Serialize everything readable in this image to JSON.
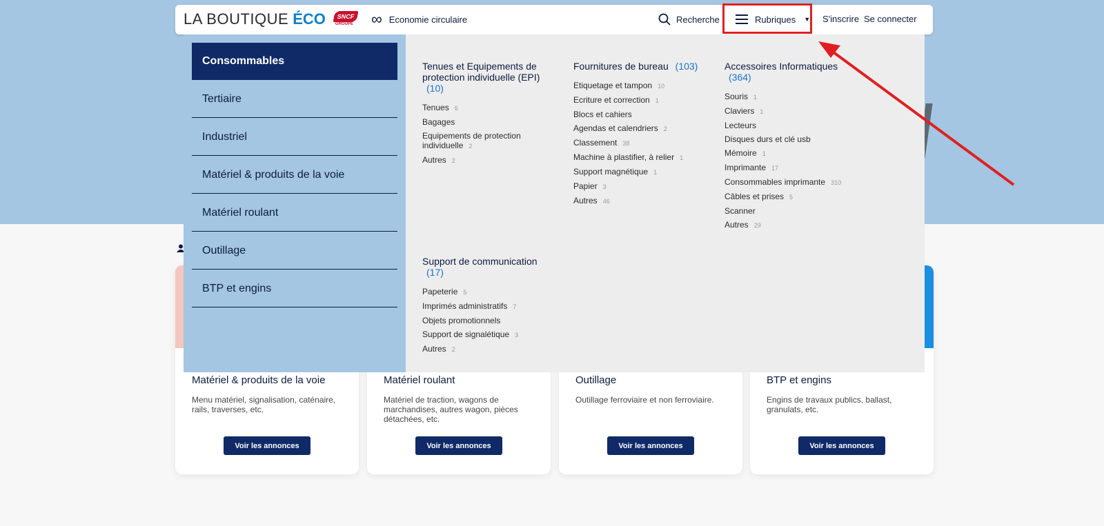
{
  "header": {
    "logo_text": "LA BOUTIQUE",
    "logo_eco": "ÉCO",
    "logo_badge": "SNCF",
    "logo_badge_sub": "GROUPE",
    "eco_link": "Economie circulaire",
    "search": "Recherche",
    "rubriques": "Rubriques",
    "signup": "S'inscrire",
    "login": "Se connecter"
  },
  "sidebar": {
    "items": [
      {
        "label": "Consommables"
      },
      {
        "label": "Tertiaire"
      },
      {
        "label": "Industriel"
      },
      {
        "label": "Matériel & produits de la voie"
      },
      {
        "label": "Matériel roulant"
      },
      {
        "label": "Outillage"
      },
      {
        "label": "BTP et engins"
      }
    ]
  },
  "menu": {
    "epi": {
      "title": "Tenues et Equipements de protection individuelle (EPI)",
      "count": "(10)",
      "items": [
        {
          "label": "Tenues",
          "n": "6"
        },
        {
          "label": "Bagages",
          "n": ""
        },
        {
          "label": "Equipements de protection individuelle",
          "n": "2"
        },
        {
          "label": "Autres",
          "n": "2"
        }
      ]
    },
    "bureau": {
      "title": "Fournitures de bureau",
      "count": "(103)",
      "items": [
        {
          "label": "Etiquetage et tampon",
          "n": "10"
        },
        {
          "label": "Ecriture et correction",
          "n": "1"
        },
        {
          "label": "Blocs et cahiers",
          "n": ""
        },
        {
          "label": "Agendas et calendriers",
          "n": "2"
        },
        {
          "label": "Classement",
          "n": "38"
        },
        {
          "label": "Machine à plastifier, à relier",
          "n": "1"
        },
        {
          "label": "Support magnétique",
          "n": "1"
        },
        {
          "label": "Papier",
          "n": "3"
        },
        {
          "label": "Autres",
          "n": "46"
        }
      ]
    },
    "info": {
      "title": "Accessoires Informatiques",
      "count": "(364)",
      "items": [
        {
          "label": "Souris",
          "n": "1"
        },
        {
          "label": "Claviers",
          "n": "1"
        },
        {
          "label": "Lecteurs",
          "n": ""
        },
        {
          "label": "Disques durs et clé usb",
          "n": ""
        },
        {
          "label": "Mémoire",
          "n": "1"
        },
        {
          "label": "Imprimante",
          "n": "17"
        },
        {
          "label": "Consommables imprimante",
          "n": "310"
        },
        {
          "label": "Câbles et prises",
          "n": "5"
        },
        {
          "label": "Scanner",
          "n": ""
        },
        {
          "label": "Autres",
          "n": "29"
        }
      ]
    },
    "comm": {
      "title": "Support de communication",
      "count": "(17)",
      "items": [
        {
          "label": "Papeterie",
          "n": "5"
        },
        {
          "label": "Imprimés administratifs",
          "n": "7"
        },
        {
          "label": "Objets promotionnels",
          "n": ""
        },
        {
          "label": "Support de signalétique",
          "n": "3"
        },
        {
          "label": "Autres",
          "n": "2"
        }
      ]
    }
  },
  "cards": [
    {
      "title": "Matériel & produits de la voie",
      "desc": "Menu matériel, signalisation, caténaire, rails, traverses, etc.",
      "button": "Voir les annonces",
      "color": "#f4c6c0"
    },
    {
      "title": "Matériel roulant",
      "desc": "Matériel de traction, wagons de marchandises, autres wagon, pièces détachées, etc.",
      "button": "Voir les annonces",
      "color": "#ededed"
    },
    {
      "title": "Outillage",
      "desc": "Outillage ferroviaire et non ferroviaire.",
      "button": "Voir les annonces",
      "color": "#ededed"
    },
    {
      "title": "BTP et engins",
      "desc": "Engins de travaux publics, ballast, granulats, etc.",
      "button": "Voir les annonces",
      "color": "#1a8fe0"
    }
  ],
  "colors": {
    "navy": "#0f2a66",
    "accent": "#1a73c9",
    "highlight": "#e02020"
  }
}
